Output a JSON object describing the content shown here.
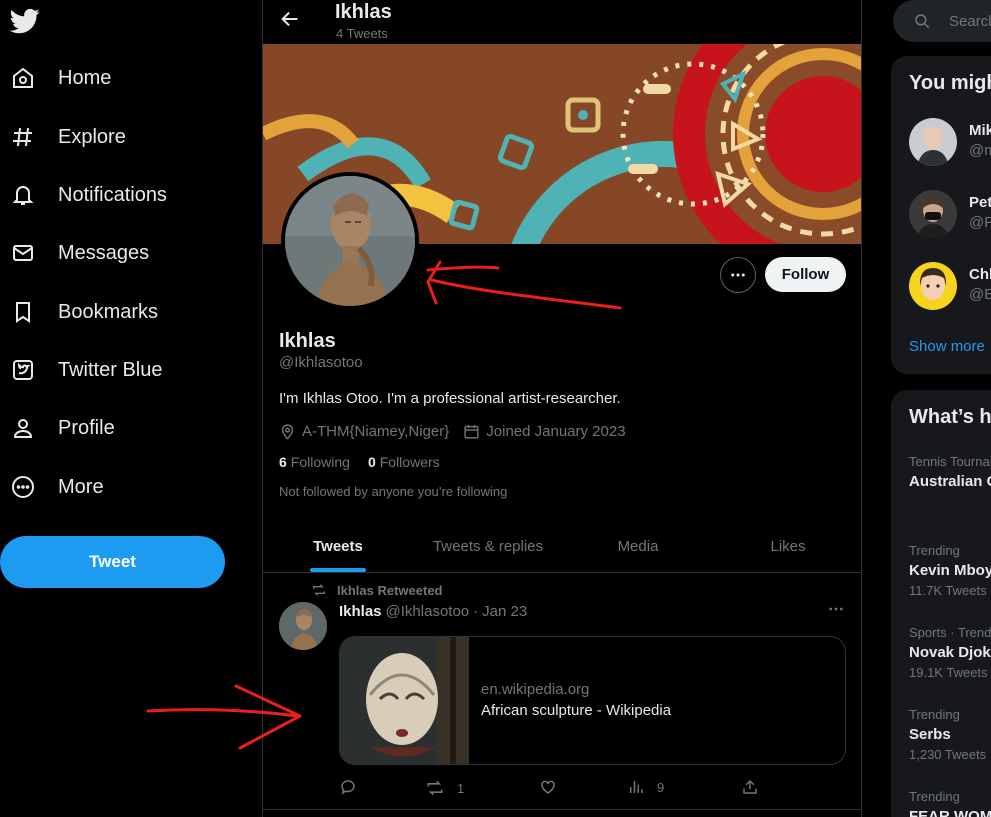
{
  "nav": {
    "items": [
      {
        "label": "Home",
        "icon": "home-icon"
      },
      {
        "label": "Explore",
        "icon": "hashtag-icon"
      },
      {
        "label": "Notifications",
        "icon": "bell-icon"
      },
      {
        "label": "Messages",
        "icon": "envelope-icon"
      },
      {
        "label": "Bookmarks",
        "icon": "bookmark-icon"
      },
      {
        "label": "Twitter Blue",
        "icon": "twitter-blue-icon"
      },
      {
        "label": "Profile",
        "icon": "person-icon"
      },
      {
        "label": "More",
        "icon": "more-circle-icon"
      }
    ],
    "tweet_button": "Tweet"
  },
  "header": {
    "title": "Ikhlas",
    "subtitle": "4 Tweets"
  },
  "profile": {
    "name": "Ikhlas",
    "handle": "@Ikhlasotoo",
    "bio": "I'm Ikhlas Otoo. I'm a professional artist-researcher.",
    "location": "A-THM{Niamey,Niger}",
    "joined": "Joined January 2023",
    "following_count": "6",
    "following_label": "Following",
    "followers_count": "0",
    "followers_label": "Followers",
    "not_followed": "Not followed by anyone you’re following",
    "follow_button": "Follow"
  },
  "tabs": [
    {
      "label": "Tweets",
      "active": true
    },
    {
      "label": "Tweets & replies",
      "active": false
    },
    {
      "label": "Media",
      "active": false
    },
    {
      "label": "Likes",
      "active": false
    }
  ],
  "tweet": {
    "retweeted_by": "Ikhlas Retweeted",
    "author_name": "Ikhlas",
    "author_handle": "@Ikhlasotoo",
    "separator": "·",
    "date": "Jan 23",
    "card_domain": "en.wikipedia.org",
    "card_title": "African sculpture - Wikipedia",
    "retweets": "1",
    "views": "9"
  },
  "sidebar": {
    "search_placeholder": "Search",
    "who_to_follow_title": "You might like",
    "suggestions": [
      {
        "name": "Mike",
        "handle": "@m"
      },
      {
        "name": "Pete",
        "handle": "@P"
      },
      {
        "name": "Chl",
        "handle": "@E"
      }
    ],
    "show_more": "Show more",
    "trends_title": "What’s happening",
    "trends": [
      {
        "context": "Tennis Tournament",
        "name": "Australian Open",
        "count": ""
      },
      {
        "context": "Trending",
        "name": "Kevin Mboyo",
        "count": "11.7K Tweets"
      },
      {
        "context": "Sports · Trending",
        "name": "Novak Djokovic",
        "count": "19.1K Tweets"
      },
      {
        "context": "Trending",
        "name": "Serbs",
        "count": "1,230 Tweets"
      },
      {
        "context": "Trending",
        "name": "FEAR WOMEN",
        "count": ""
      }
    ]
  },
  "colors": {
    "accent": "#1d9bf0",
    "annotation": "#e8201a"
  }
}
